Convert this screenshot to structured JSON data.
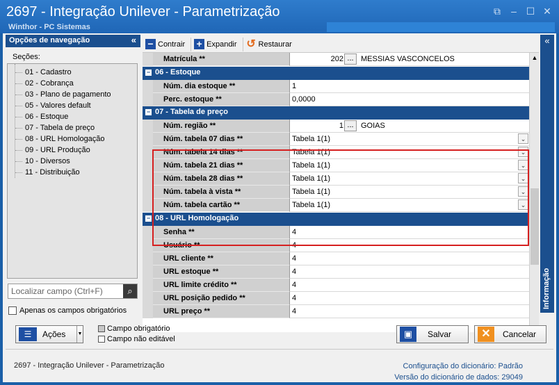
{
  "window": {
    "title": "2697 - Integração Unilever - Parametrização",
    "subtitle": "Winthor - PC Sistemas"
  },
  "nav": {
    "header": "Opções de navegação",
    "sections_label": "Seções:",
    "items": [
      "01 - Cadastro",
      "02 - Cobrança",
      "03 - Plano de pagamento",
      "05 - Valores default",
      "06 - Estoque",
      "07 - Tabela de preço",
      "08 - URL Homologação",
      "09 - URL Produção",
      "10 - Diversos",
      "11 - Distribuição"
    ],
    "search_placeholder": "Localizar campo (Ctrl+F)",
    "only_required_label": "Apenas os campos obrigatórios"
  },
  "toolbar": {
    "contrair": "Contrair",
    "expandir": "Expandir",
    "restaurar": "Restaurar"
  },
  "grid": {
    "matricula": {
      "label": "Matrícula **",
      "code": "202",
      "name": "MESSIAS VASCONCELOS"
    },
    "sec_estoque": "06 - Estoque",
    "dia_estoque": {
      "label": "Núm. dia estoque **",
      "value": "1"
    },
    "perc_estoque": {
      "label": "Perc. estoque **",
      "value": "0,0000"
    },
    "sec_tabela": "07 - Tabela de preço",
    "regiao": {
      "label": "Núm. região **",
      "code": "1",
      "name": "GOIAS"
    },
    "tab07": {
      "label": "Núm. tabela 07 dias **",
      "value": "Tabela 1(1)"
    },
    "tab14": {
      "label": "Núm. tabela 14 dias **",
      "value": "Tabela 1(1)"
    },
    "tab21": {
      "label": "Núm. tabela 21 dias **",
      "value": "Tabela 1(1)"
    },
    "tab28": {
      "label": "Núm. tabela 28 dias **",
      "value": "Tabela 1(1)"
    },
    "tabvista": {
      "label": "Núm. tabela à vista **",
      "value": "Tabela 1(1)"
    },
    "tabcartao": {
      "label": "Núm. tabela cartão **",
      "value": "Tabela 1(1)"
    },
    "sec_url": "08 - URL Homologação",
    "senha": {
      "label": "Senha **",
      "value": "4"
    },
    "usuario": {
      "label": "Usuário **",
      "value": "4"
    },
    "url_cliente": {
      "label": "URL cliente **",
      "value": "4"
    },
    "url_estoque": {
      "label": "URL estoque **",
      "value": "4"
    },
    "url_limite": {
      "label": "URL limite crédito **",
      "value": "4"
    },
    "url_posicao": {
      "label": "URL posição pedido **",
      "value": "4"
    },
    "url_preco": {
      "label": "URL preço **",
      "value": "4"
    }
  },
  "info_panel": {
    "label": "Informação"
  },
  "bottom": {
    "acoes": "Ações",
    "legend_required": "Campo obrigatório",
    "legend_noneditable": "Campo não editável",
    "salvar": "Salvar",
    "cancelar": "Cancelar"
  },
  "footer": {
    "left": "2697 - Integração Unilever - Parametrização",
    "config_label": "Configuração do dicionário:",
    "config_value": "Padrão",
    "version_label": "Versão do dicionário de dados:",
    "version_value": "29049"
  }
}
